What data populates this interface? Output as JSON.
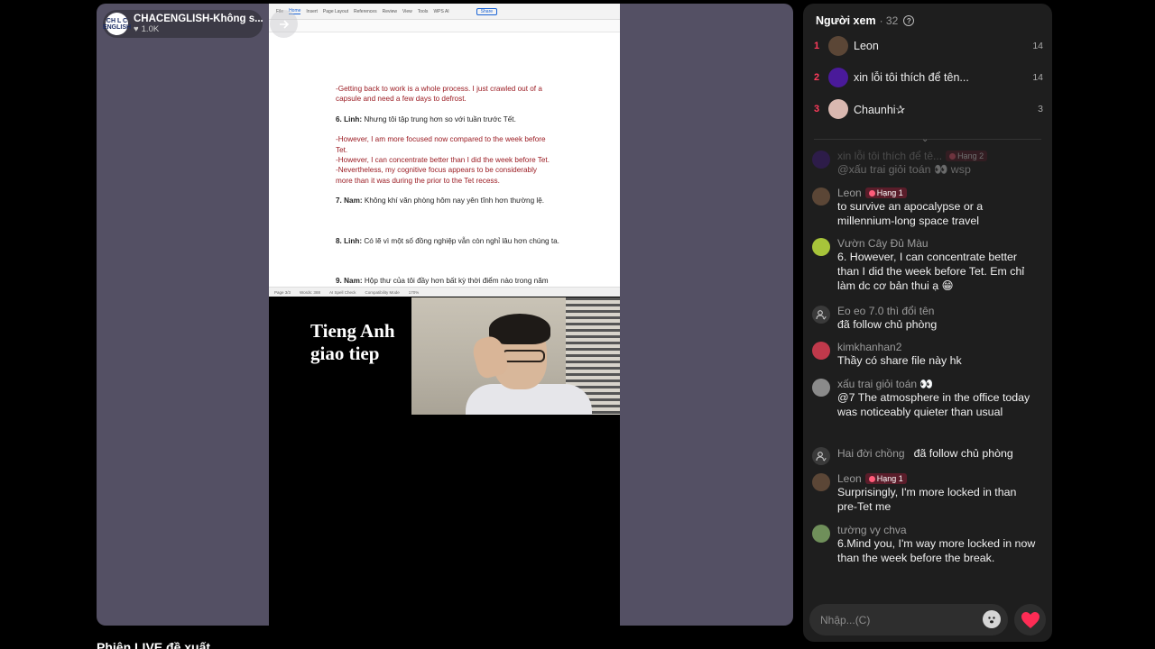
{
  "host": {
    "avatar_text": "CH L C ENGLISH",
    "name": "CHACENGLISH-Không s...",
    "likes": "1.0K"
  },
  "video": {
    "caption_line1": "Tieng Anh",
    "caption_line2": "giao tiep",
    "doc_tabs": [
      "File",
      "Home",
      "Insert",
      "Page Layout",
      "References",
      "Review",
      "View",
      "Tools",
      "WPS AI"
    ],
    "doc_share": "Share",
    "doc_lines": [
      {
        "type": "red",
        "text": "-Getting back to work is a whole process. I just crawled out of a"
      },
      {
        "type": "red",
        "text": "capsule and need a few days to defrost."
      },
      {
        "type": "gap"
      },
      {
        "type": "num",
        "bold": "6. Linh:",
        "text": " Nhưng tôi tập trung hơn so với tuần trước Tết."
      },
      {
        "type": "gap"
      },
      {
        "type": "red",
        "text": "-However, I am more focused now compared to the week before"
      },
      {
        "type": "red",
        "text": "Tet."
      },
      {
        "type": "red",
        "text": "-However, I can concentrate better than I did the week before Tet."
      },
      {
        "type": "red",
        "text": "-Nevertheless, my cognitive focus appears to be considerably"
      },
      {
        "type": "red",
        "text": "more than it was during the prior to the Tet recess."
      },
      {
        "type": "gap"
      },
      {
        "type": "num",
        "bold": "7. Nam:",
        "text": " Không khí văn phòng hôm nay yên tĩnh hơn thường lệ."
      },
      {
        "type": "gap2"
      },
      {
        "type": "gap"
      },
      {
        "type": "num",
        "bold": "8. Linh:",
        "text": " Có lẽ vì một số đồng nghiệp vẫn còn nghỉ lâu hơn chúng ta."
      },
      {
        "type": "gap2"
      },
      {
        "type": "gap"
      },
      {
        "type": "num",
        "bold": "9. Nam:",
        "text": " Hộp thư của tôi đầy hơn bất kỳ thời điểm nào trong năm"
      }
    ],
    "doc_status": [
      "Page 3/3",
      "Words: 388",
      "AI Spell Check",
      "Compatibility Mode",
      "170%"
    ]
  },
  "suggest_title": "Phiên LIVE đề xuất",
  "viewers": {
    "title": "Người xem",
    "count": "· 32",
    "ranks": [
      {
        "rank": "1",
        "name": "Leon",
        "score": "14",
        "color": "#5b4636"
      },
      {
        "rank": "2",
        "name": "xin lỗi tôi thích để tên...",
        "score": "14",
        "color": "#4a1a9a"
      },
      {
        "rank": "3",
        "name": "Chaunhi✰",
        "score": "3",
        "color": "#d9b8b0"
      }
    ]
  },
  "messages": [
    {
      "name": "xin lỗi tôi thích để tê...",
      "badge": "Hạng 2",
      "text": "@xấu trai giỏi toán 👀 wsp",
      "color": "#4a1a9a",
      "faded": true
    },
    {
      "name": "Leon",
      "badge": "Hạng 1",
      "text": "to survive an apocalypse or a millennium-long space travel",
      "color": "#5b4636"
    },
    {
      "name": "Vườn Cây Đủ Màu",
      "badge": "",
      "text": "6. However, I can concentrate better than I did the week before Tet. Em chỉ làm dc cơ bản thui ạ 😁",
      "color": "#a7c43a"
    },
    {
      "name": "Eo eo 7.0 thì đổi tên",
      "badge": "",
      "text": " đã follow chủ phòng",
      "color": "user"
    },
    {
      "name": "kimkhanhan2",
      "badge": "",
      "text": "Thầy có share file này hk",
      "color": "#c0394b"
    },
    {
      "name": "xấu trai giỏi toán 👀",
      "badge": "",
      "text": "@7 The atmosphere in the office today was noticeably quieter than usual",
      "color": "#8a8a8a"
    },
    {
      "name": "Hai đời chồng",
      "badge": "",
      "text": "đã follow chủ phòng",
      "color": "user",
      "inline": true
    },
    {
      "name": "Leon",
      "badge": "Hạng 1",
      "text": "Surprisingly, I'm more locked in than pre-Tet me",
      "color": "#5b4636"
    },
    {
      "name": "tường vy chva",
      "badge": "",
      "text": "6.Mind you, I'm way more locked in now than the week before the break.",
      "color": "#6f8f5a"
    }
  ],
  "input": {
    "placeholder": "Nhập...(C)"
  }
}
